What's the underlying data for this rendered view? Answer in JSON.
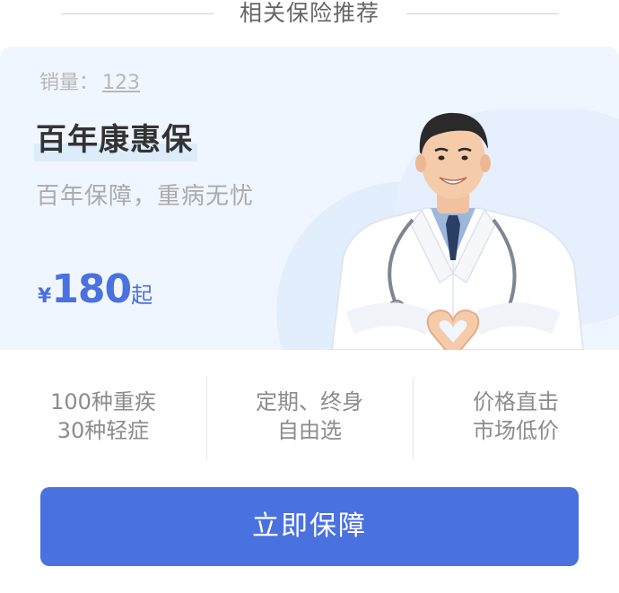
{
  "section": {
    "title": "相关保险推荐"
  },
  "product": {
    "sales_label": "销量：",
    "sales_count": "123",
    "title": "百年康惠保",
    "subtitle": "百年保障，重病无忧",
    "price_currency": "¥",
    "price_amount": "180",
    "price_suffix": "起",
    "image": "doctor-making-heart-gesture"
  },
  "features": [
    {
      "line1": "100种重疾",
      "line2": "30种轻症"
    },
    {
      "line1": "定期、终身",
      "line2": "自由选"
    },
    {
      "line1": "价格直击",
      "line2": "市场低价"
    }
  ],
  "cta": {
    "label": "立即保障"
  },
  "colors": {
    "accent": "#4a71e0",
    "card_bg": "#f0f6ff"
  }
}
